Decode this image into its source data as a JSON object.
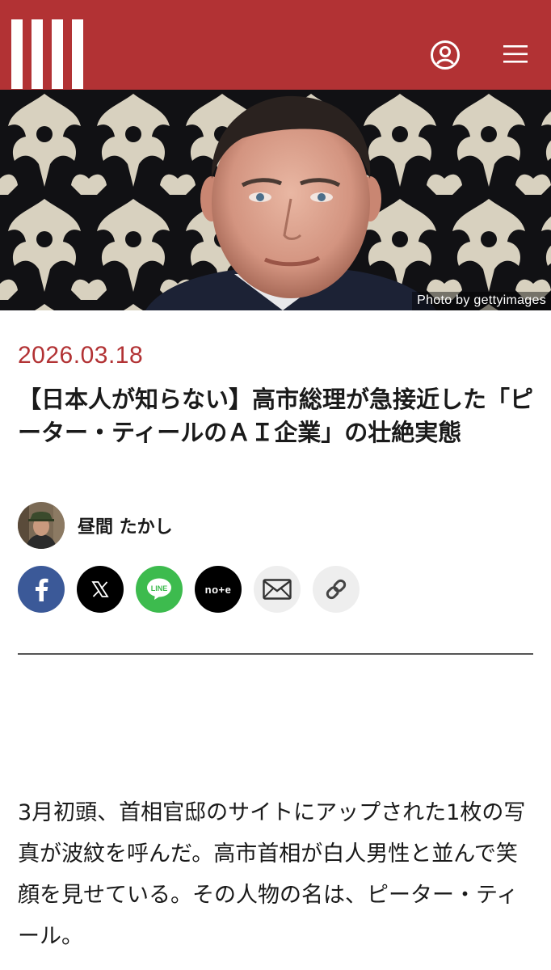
{
  "header": {
    "logo_icon": "brand-stripes-logo",
    "user_icon": "user-account-icon",
    "menu_icon": "hamburger-menu-icon",
    "brand_color": "#b23234"
  },
  "hero": {
    "credit": "Photo by gettyimages"
  },
  "article": {
    "date": "2026.03.18",
    "title": "【日本人が知らない】高市総理が急接近した「ピーター・ティールのＡＩ企業」の壮絶実態",
    "author": "昼間 たかし",
    "body": "3月初頭、首相官邸のサイトにアップされた1枚の写真が波紋を呼んだ。高市首相が白人男性と並んで笑顔を見せている。その人物の名は、ピーター・ティール。"
  },
  "share": {
    "facebook_icon": "facebook-icon",
    "x_icon": "x-icon",
    "line_label": "LINE",
    "note_label": "no+e",
    "mail_icon": "mail-icon",
    "link_icon": "link-icon"
  }
}
